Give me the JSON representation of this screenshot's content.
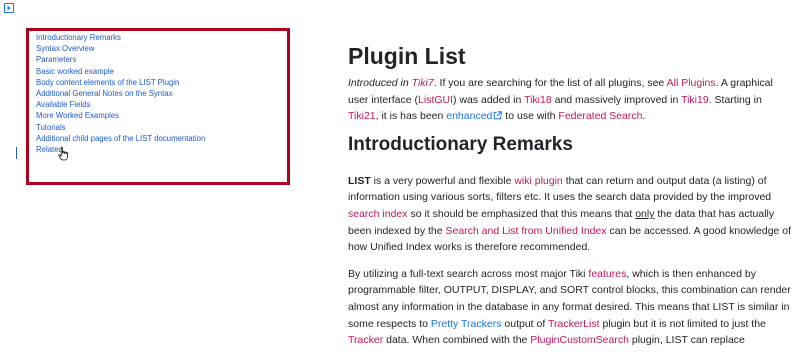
{
  "toc": {
    "items": [
      {
        "label": "Introductionary Remarks"
      },
      {
        "label": "Syntax Overview"
      },
      {
        "label": "Parameters"
      },
      {
        "label": "Basic worked example"
      },
      {
        "label": "Body content elements of the LIST Plugin"
      },
      {
        "label": "Additional General Notes on the Syntax"
      },
      {
        "label": "Available Fields"
      },
      {
        "label": "More Worked Examples"
      },
      {
        "label": "Tutorials"
      },
      {
        "label": "Additional child pages of the LIST documentation"
      },
      {
        "label": "Related"
      }
    ]
  },
  "page": {
    "title": "Plugin List",
    "intro": {
      "introduced_in": "Introduced in ",
      "tiki7": "Tiki7",
      "t1": ". If you are searching for the list of all plugins, see ",
      "all_plugins": "All Plugins",
      "t2": ". A graphical user interface (",
      "listgui": "ListGUI",
      "t3": ") was added in ",
      "tiki18": "Tiki18",
      "t4": " and massively improved in ",
      "tiki19": "Tiki19",
      "t5": ". Starting in ",
      "tiki21": "Tiki21",
      "t6": ", it is has been ",
      "enhanced": "enhanced",
      "t7": " to use with ",
      "federated_search": "Federated Search",
      "t8": "."
    },
    "section_title": "Introductionary Remarks",
    "para1": {
      "list_bold": "LIST",
      "t1": " is a very powerful and flexible ",
      "wiki_plugin": "wiki plugin",
      "t2": " that can return and output data (a listing) of information using various sorts, filters etc. It uses the search data provided by the improved ",
      "search_index": "search index",
      "t3": " so it should be emphasized that this means that ",
      "only": "only",
      "t4": " the data that has actually been indexed by the ",
      "search_list_unified": "Search and List from Unified Index",
      "t5": " can be accessed. A good knowledge of how Unified Index works is therefore recommended."
    },
    "para2": {
      "t1": "By utilizing a full-text search across most major Tiki ",
      "features": "features",
      "t2": ", which is then enhanced by programmable filter, OUTPUT, DISPLAY, and SORT control blocks, this combination can render almost any information in the database in any format desired. This means that LIST is similar in some respects to ",
      "pretty_trackers": "Pretty Trackers",
      "t3": " output of ",
      "trackerlist": "TrackerList",
      "t4": " plugin but it is not limited to just the ",
      "tracker": "Tracker",
      "t5": " data. When combined with the ",
      "plugincustomsearch": "PluginCustomSearch",
      "t6": " plugin, LIST can replace"
    }
  },
  "colors": {
    "red_link": "#c2185b",
    "blue_link": "#1a73e8",
    "toc_border": "#b00020",
    "text": "#212529"
  },
  "icons": {
    "toc_toggle": "chevron-right-icon",
    "external_link": "external-link-icon",
    "cursor": "hand-cursor-icon"
  }
}
